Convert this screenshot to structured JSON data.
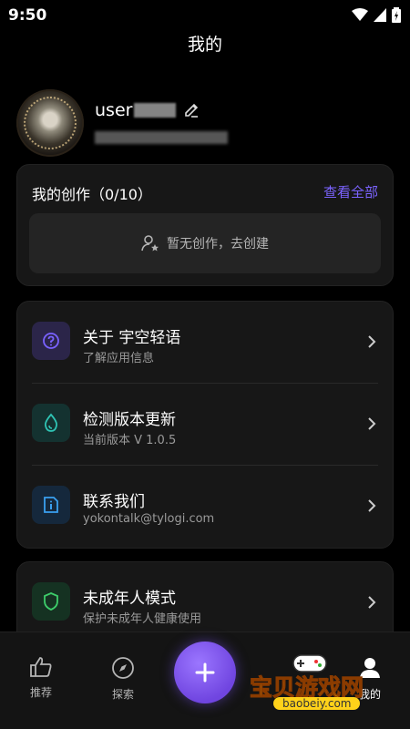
{
  "status_bar": {
    "time": "9:50",
    "wifi_icon": "wifi-icon",
    "signal_icon": "signal-icon",
    "battery_icon": "battery-icon"
  },
  "header": {
    "title": "我的"
  },
  "profile": {
    "username": "user",
    "edit_icon": "pencil-icon"
  },
  "creation": {
    "title": "我的创作（0/10）",
    "view_all": "查看全部",
    "empty_text": "暂无创作，去创建"
  },
  "menu": [
    {
      "title": "关于 宇空轻语",
      "subtitle": "了解应用信息",
      "icon": "question-icon",
      "color": "#7a62ff",
      "bg": "#2b2549"
    },
    {
      "title": "检测版本更新",
      "subtitle": "当前版本 V 1.0.5",
      "icon": "drop-icon",
      "color": "#2fc4b4",
      "bg": "#143230"
    },
    {
      "title": "联系我们",
      "subtitle": "yokontalk@tylogi.com",
      "icon": "info-icon",
      "color": "#3aa0f0",
      "bg": "#15283c"
    }
  ],
  "menu2": [
    {
      "title": "未成年人模式",
      "subtitle": "保护未成年人健康使用",
      "icon": "shield-icon",
      "color": "#3dcc6a",
      "bg": "#153222"
    }
  ],
  "tabbar": {
    "recommend": "推荐",
    "explore": "探索",
    "mine": "我的",
    "add_icon": "plus-icon"
  },
  "watermark": {
    "text": "宝贝游戏网",
    "url": "baobeiy.com"
  }
}
